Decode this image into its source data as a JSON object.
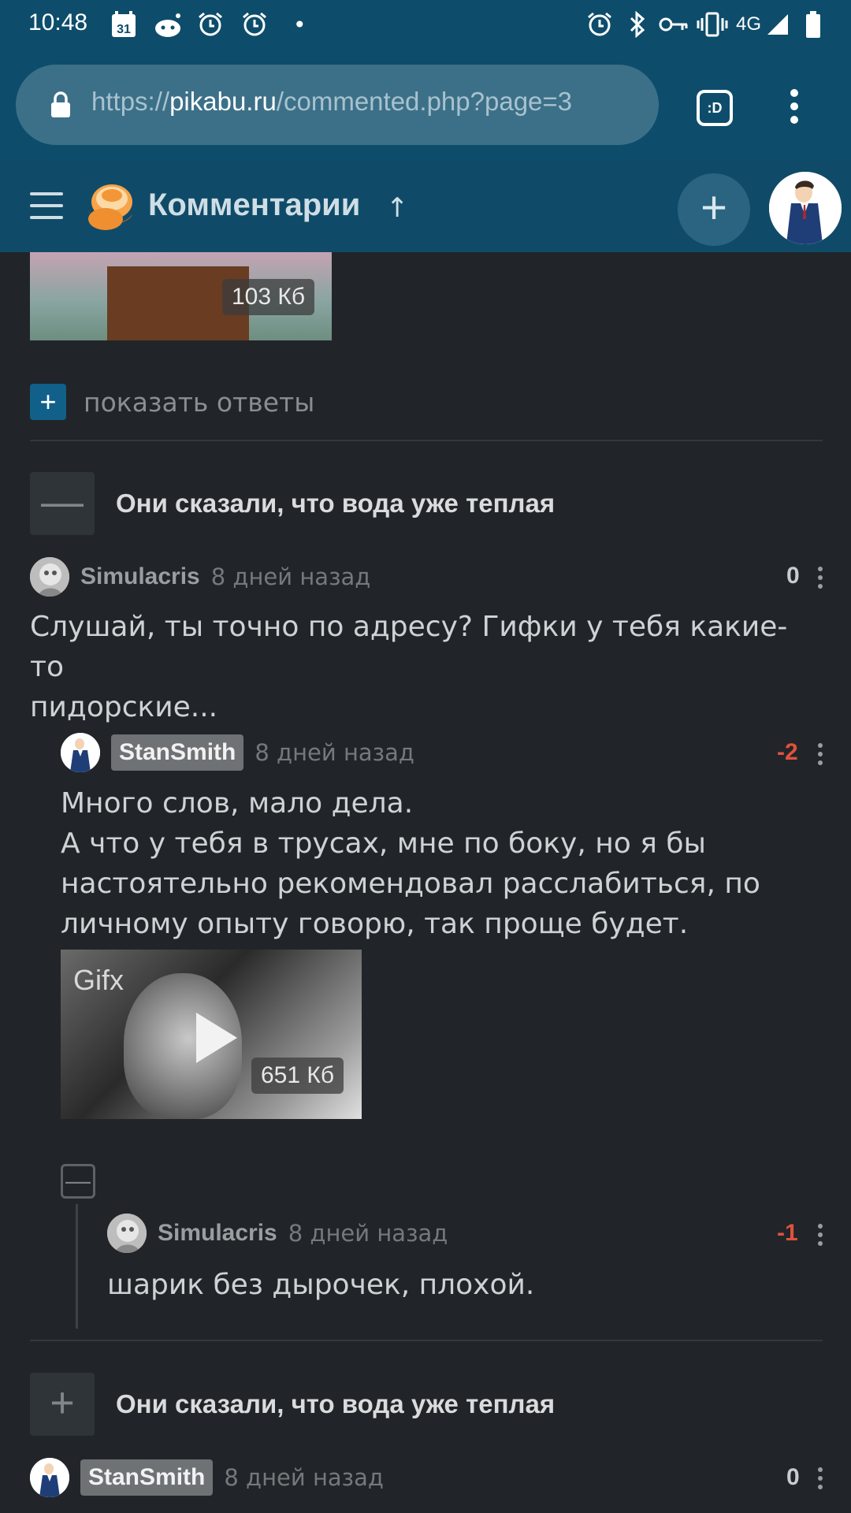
{
  "status_bar": {
    "time": "10:48",
    "calendar_day": "31",
    "network": "4G",
    "dot": "•"
  },
  "browser": {
    "url_prefix": "https://",
    "url_host": "pikabu.ru",
    "url_path": "/commented.php?page=3",
    "tab_switcher_label": ":D"
  },
  "header": {
    "title": "Комментарии",
    "sort_arrow": "↑",
    "add_label": "+"
  },
  "top_image": {
    "size": "103 Кб"
  },
  "show_replies": {
    "plus": "+",
    "label": "показать ответы"
  },
  "stories": [
    {
      "toggle": "—",
      "title": "Они сказали, что вода уже теплая"
    },
    {
      "toggle": "+",
      "title": "Они сказали, что вода уже теплая"
    }
  ],
  "comments": [
    {
      "author": "Simulacris",
      "date": "8 дней назад",
      "rating": "0",
      "text_lines": [
        "Слушай, ты точно по адресу? Гифки у тебя какие-то",
        "пидорские..."
      ]
    },
    {
      "author": "StanSmith",
      "date": "8 дней назад",
      "rating": "-2",
      "text_lines": [
        "Много слов, мало дела.",
        "А что у тебя в трусах, мне по боку, но я бы",
        "настоятельно рекомендовал расслабиться, по",
        "личному опыту говорю, так проще будет."
      ],
      "gif": {
        "watermark": "Gifx",
        "size": "651 Кб"
      }
    },
    {
      "author": "Simulacris",
      "date": "8 дней назад",
      "rating": "-1",
      "text_lines": [
        "шарик без дырочек, плохой."
      ]
    },
    {
      "author": "StanSmith",
      "date": "8 дней назад",
      "rating": "0"
    }
  ],
  "thread_collapse": "—",
  "colors": {
    "header_bg": "#0f4b68",
    "page_bg": "#212529",
    "negative_rating": "#e0513e",
    "neutral_rating": "#c9ccce"
  }
}
